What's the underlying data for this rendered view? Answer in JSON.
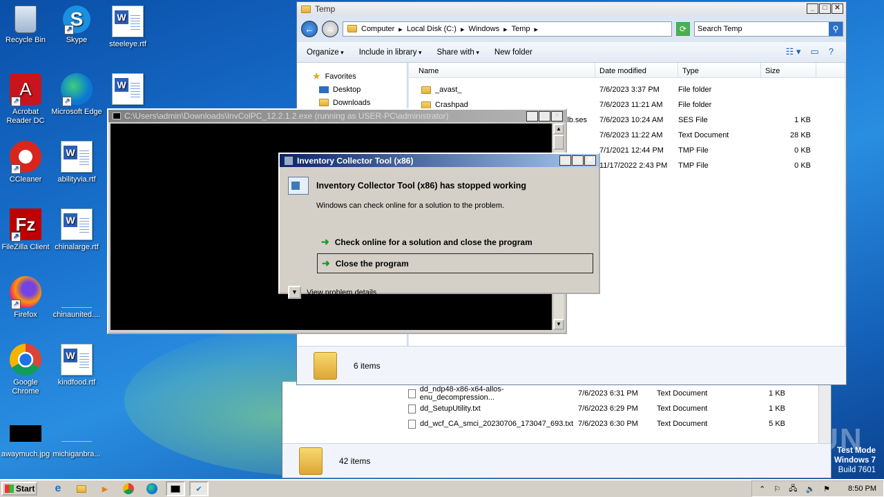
{
  "desktop": {
    "icons": [
      {
        "label": "Recycle Bin"
      },
      {
        "label": "Skype"
      },
      {
        "label": "steeleye.rtf"
      },
      {
        "label": "Acrobat Reader DC"
      },
      {
        "label": "Microsoft Edge"
      },
      {
        "label": "CCleaner"
      },
      {
        "label": "abilityvia.rtf"
      },
      {
        "label": "FileZilla Client"
      },
      {
        "label": "chinalarge.rtf"
      },
      {
        "label": "Firefox"
      },
      {
        "label": "chinaunited...."
      },
      {
        "label": "Google Chrome"
      },
      {
        "label": "kindfood.rtf"
      },
      {
        "label": "awaymuch.jpg"
      },
      {
        "label": "michiganbra..."
      }
    ]
  },
  "explorer": {
    "title": "Temp",
    "breadcrumb": [
      "Computer",
      "Local Disk (C:)",
      "Windows",
      "Temp"
    ],
    "search_placeholder": "Search Temp",
    "commands": [
      "Organize",
      "Include in library",
      "Share with",
      "New folder"
    ],
    "nav": [
      "Favorites",
      "Desktop",
      "Downloads"
    ],
    "columns": [
      "Name",
      "Date modified",
      "Type",
      "Size"
    ],
    "rows": [
      {
        "name": "_avast_",
        "date": "7/6/2023 3:37 PM",
        "type": "File folder",
        "size": ""
      },
      {
        "name": "Crashpad",
        "date": "7/6/2023 11:21 AM",
        "type": "File folder",
        "size": ""
      },
      {
        "name": "lb.ses",
        "date": "7/6/2023 10:24 AM",
        "type": "SES File",
        "size": "1 KB"
      },
      {
        "name": "",
        "date": "7/6/2023 11:22 AM",
        "type": "Text Document",
        "size": "28 KB"
      },
      {
        "name": "",
        "date": "7/1/2021 12:44 PM",
        "type": "TMP File",
        "size": "0 KB"
      },
      {
        "name": "",
        "date": "11/17/2022 2:43 PM",
        "type": "TMP File",
        "size": "0 KB"
      }
    ],
    "status": "6 items"
  },
  "explorer_back": {
    "rows": [
      {
        "name": "dd_ndp48-x86-x64-allos-enu_decompression...",
        "date": "7/6/2023 6:31 PM",
        "type": "Text Document",
        "size": "1 KB"
      },
      {
        "name": "dd_SetupUtility.txt",
        "date": "7/6/2023 6:29 PM",
        "type": "Text Document",
        "size": "1 KB"
      },
      {
        "name": "dd_wcf_CA_smci_20230706_173047_693.txt",
        "date": "7/6/2023 6:30 PM",
        "type": "Text Document",
        "size": "5 KB"
      }
    ],
    "status": "42 items"
  },
  "console": {
    "title": "C:\\Users\\admin\\Downloads\\InvColPC_12.2.1.2.exe (running as USER-PC\\administrator)"
  },
  "dialog": {
    "title": "Inventory Collector Tool (x86)",
    "heading": "Inventory Collector Tool (x86) has stopped working",
    "subtext": "Windows can check online for a solution to the problem.",
    "option1": "Check online for a solution and close the program",
    "option2": "Close the program",
    "details": "View problem details"
  },
  "taskbar": {
    "start": "Start",
    "clock": "8:50 PM"
  },
  "watermark": {
    "line1": "Test Mode",
    "line2": "Windows 7",
    "line3": "Build 7601",
    "brand": "ANY RUN"
  }
}
